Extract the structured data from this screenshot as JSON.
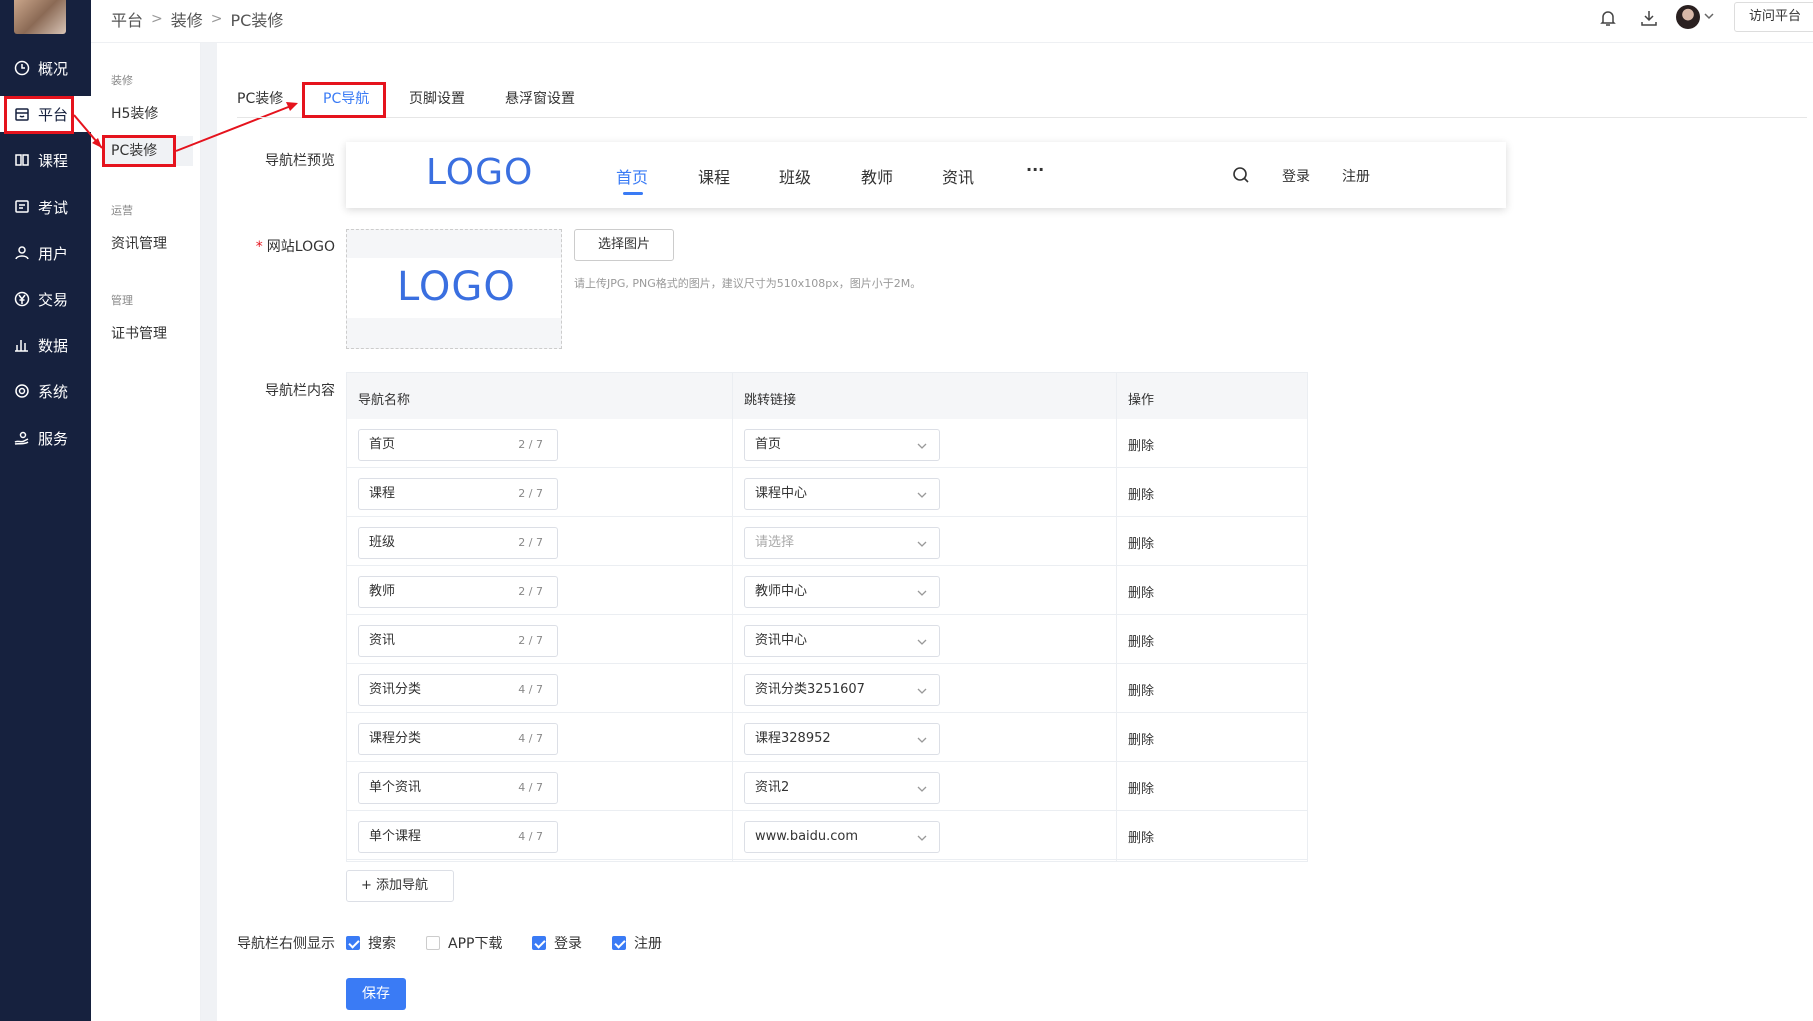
{
  "leftnav": {
    "items": [
      {
        "label": "概况",
        "icon": "clock-icon"
      },
      {
        "label": "平台",
        "icon": "store-icon"
      },
      {
        "label": "课程",
        "icon": "book-icon"
      },
      {
        "label": "考试",
        "icon": "exam-icon"
      },
      {
        "label": "用户",
        "icon": "user-icon"
      },
      {
        "label": "交易",
        "icon": "yen-icon"
      },
      {
        "label": "数据",
        "icon": "bar-chart-icon"
      },
      {
        "label": "系统",
        "icon": "gear-icon"
      },
      {
        "label": "服务",
        "icon": "service-icon"
      }
    ]
  },
  "subnav": {
    "group1": "装修",
    "h5": "H5装修",
    "pc": "PC装修",
    "group2": "运营",
    "news": "资讯管理",
    "group3": "管理",
    "cert": "证书管理"
  },
  "breadcrumb": [
    "平台",
    "装修",
    "PC装修"
  ],
  "topbar": {
    "visit": "访问平台"
  },
  "tabs": [
    "PC装修",
    "PC导航",
    "页脚设置",
    "悬浮窗设置"
  ],
  "labels": {
    "preview": "导航栏预览",
    "logo": "网站LOGO",
    "content": "导航栏内容",
    "right": "导航栏右侧显示"
  },
  "preview": {
    "logo": "LOGO",
    "nav": [
      "首页",
      "课程",
      "班级",
      "教师",
      "资讯"
    ],
    "more": "···",
    "login": "登录",
    "register": "注册"
  },
  "logo_upload": {
    "logo": "LOGO",
    "button": "选择图片",
    "hint": "请上传JPG, PNG格式的图片，建议尺寸为510x108px，图片小于2M。"
  },
  "table": {
    "headers": [
      "导航名称",
      "跳转链接",
      "操作"
    ],
    "rows": [
      {
        "name": "首页",
        "count": "2 / 7",
        "link": "首页",
        "placeholder": false
      },
      {
        "name": "课程",
        "count": "2 / 7",
        "link": "课程中心",
        "placeholder": false
      },
      {
        "name": "班级",
        "count": "2 / 7",
        "link": "请选择",
        "placeholder": true
      },
      {
        "name": "教师",
        "count": "2 / 7",
        "link": "教师中心",
        "placeholder": false
      },
      {
        "name": "资讯",
        "count": "2 / 7",
        "link": "资讯中心",
        "placeholder": false
      },
      {
        "name": "资讯分类",
        "count": "4 / 7",
        "link": "资讯分类3251607",
        "placeholder": false
      },
      {
        "name": "课程分类",
        "count": "4 / 7",
        "link": "课程328952",
        "placeholder": false
      },
      {
        "name": "单个资讯",
        "count": "4 / 7",
        "link": "资讯2",
        "placeholder": false
      },
      {
        "name": "单个课程",
        "count": "4 / 7",
        "link": "www.baidu.com",
        "placeholder": false
      }
    ],
    "delete": "删除"
  },
  "add_nav": "+ 添加导航",
  "right_options": [
    {
      "label": "搜索",
      "checked": true
    },
    {
      "label": "APP下载",
      "checked": false
    },
    {
      "label": "登录",
      "checked": true
    },
    {
      "label": "注册",
      "checked": true
    }
  ],
  "save": "保存",
  "colors": {
    "accent": "#3a7bf5",
    "sidebar": "#16213e",
    "highlight": "#e5131d"
  }
}
